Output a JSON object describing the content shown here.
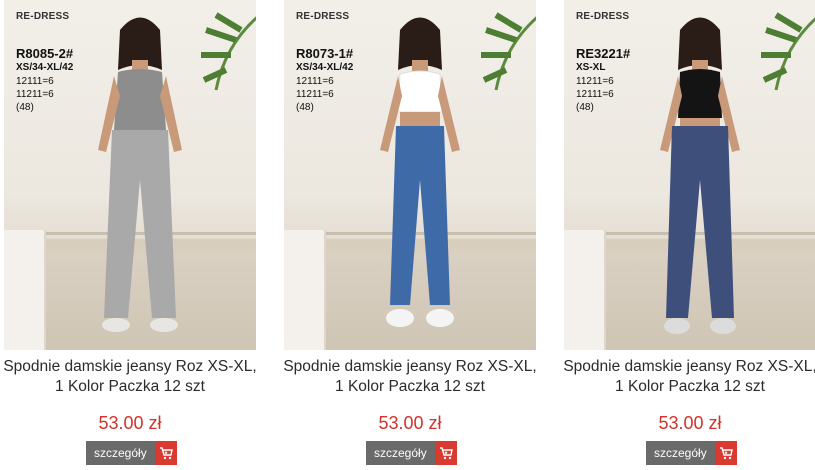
{
  "products": [
    {
      "brand": "RE-DRESS",
      "code": "R8085-2#",
      "size": "XS/34-XL/42",
      "line1": "12111=6",
      "line2": "11211=6",
      "line3": "(48)",
      "title": "Spodnie damskie jeansy Roz XS-XL, 1 Kolor Paczka 12 szt",
      "price": "53.00 zł",
      "details_label": "szczegóły",
      "cart_icon": "cart-icon",
      "top_color": "#8d8d8d",
      "jeans_color": "#a9a9aa",
      "shoe_color": "#e8e6e2"
    },
    {
      "brand": "RE-DRESS",
      "code": "R8073-1#",
      "size": "XS/34-XL/42",
      "line1": "12111=6",
      "line2": "11211=6",
      "line3": "(48)",
      "title": "Spodnie damskie jeansy Roz XS-XL, 1 Kolor Paczka 12 szt",
      "price": "53.00 zł",
      "details_label": "szczegóły",
      "cart_icon": "cart-icon",
      "top_color": "#ffffff",
      "jeans_color": "#3f6aa8",
      "shoe_color": "#f4f4f4"
    },
    {
      "brand": "RE-DRESS",
      "code": "RE3221#",
      "size": "XS-XL",
      "line1": "11211=6",
      "line2": "12111=6",
      "line3": "(48)",
      "title": "Spodnie damskie jeansy Roz XS-XL, 1 Kolor Paczka 12 szt",
      "price": "53.00 zł",
      "details_label": "szczegóły",
      "cart_icon": "cart-icon",
      "top_color": "#141414",
      "jeans_color": "#3d4f7a",
      "shoe_color": "#dcdcdc"
    }
  ]
}
